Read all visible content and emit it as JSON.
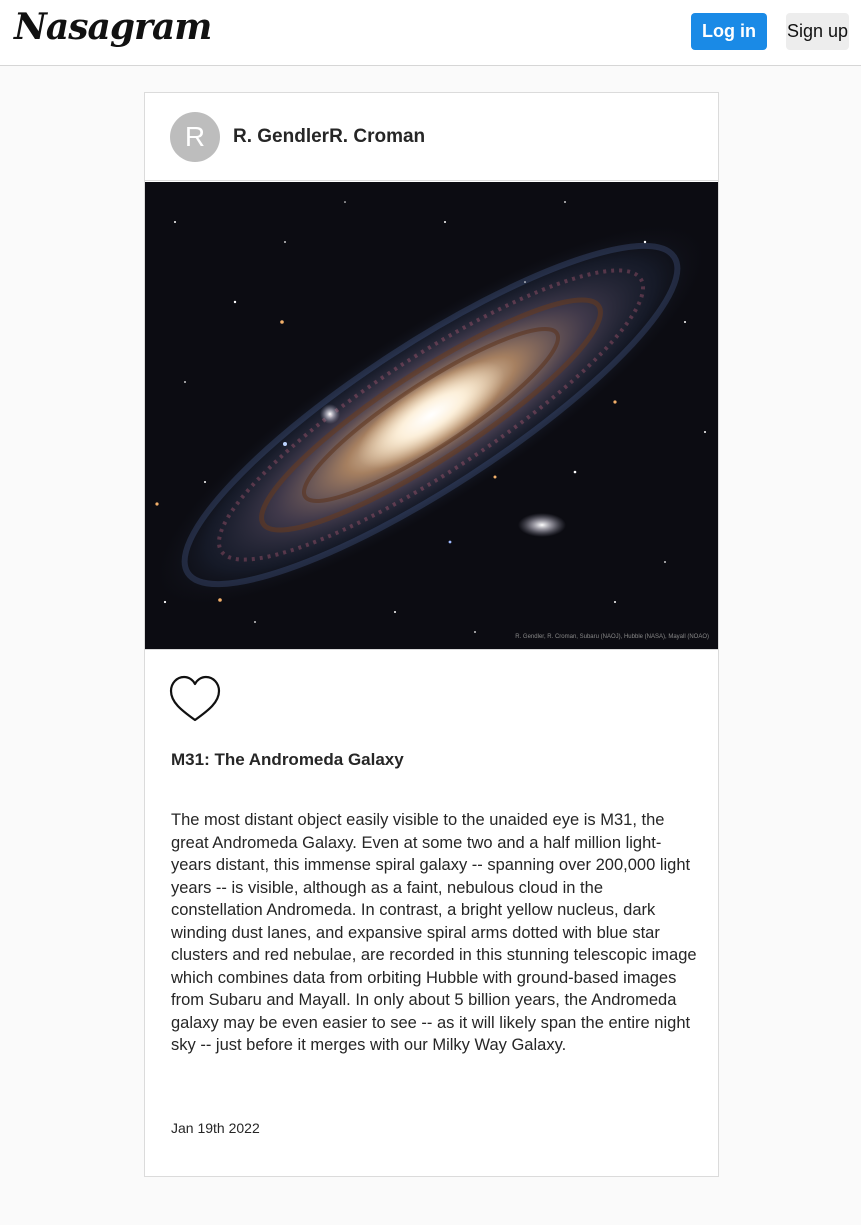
{
  "header": {
    "logo": "Nasagram",
    "login_label": "Log in",
    "signup_label": "Sign up",
    "colors": {
      "login_bg": "#1a8ae6",
      "signup_bg": "#ededed"
    }
  },
  "post": {
    "avatar_letter": "R",
    "author": "R. GendlerR. Croman",
    "image_alt": "M31: The Andromeda Galaxy",
    "image_credit": "R. Gendler, R. Croman, Subaru (NAOJ), Hubble (NASA), Mayall (NOAO)",
    "like_icon": "heart-outline-icon",
    "title": "M31: The Andromeda Galaxy",
    "description": "The most distant object easily visible to the unaided eye is M31, the great Andromeda Galaxy. Even at some two and a half million light-years distant, this immense spiral galaxy -- spanning over 200,000 light years -- is visible, although as a faint, nebulous cloud in the constellation Andromeda. In contrast, a bright yellow nucleus, dark winding dust lanes, and expansive spiral arms dotted with blue star clusters and red nebulae, are recorded in this stunning telescopic image which combines data from orbiting Hubble with ground-based images from Subaru and Mayall. In only about 5 billion years, the Andromeda galaxy may be even easier to see -- as it will likely span the entire night sky -- just before it merges with our Milky Way Galaxy.",
    "date": "Jan 19th 2022"
  }
}
